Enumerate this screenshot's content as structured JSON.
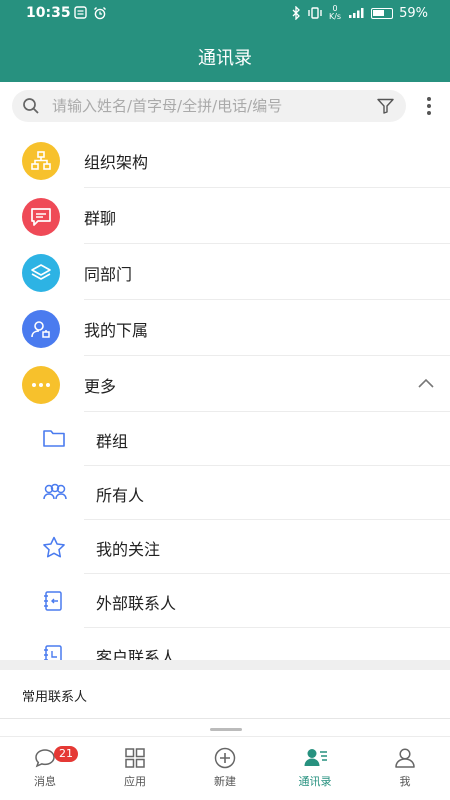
{
  "status_bar": {
    "time": "10:35",
    "battery": "59%",
    "net_speed_value": "0",
    "net_speed_unit": "K/s"
  },
  "header": {
    "title": "通讯录"
  },
  "search": {
    "placeholder": "请输入姓名/首字母/全拼/电话/编号",
    "icon": "search-icon",
    "filter_icon": "filter-icon"
  },
  "menu_items": [
    {
      "label": "组织架构",
      "icon": "org-chart-icon",
      "color": "#f7c12c"
    },
    {
      "label": "群聊",
      "icon": "chat-icon",
      "color": "#ef4a57"
    },
    {
      "label": "同部门",
      "icon": "layers-icon",
      "color": "#2db3e4"
    },
    {
      "label": "我的下属",
      "icon": "subordinate-icon",
      "color": "#4a7bef"
    },
    {
      "label": "更多",
      "icon": "more-icon",
      "color": "#f7c12c",
      "expanded": true
    }
  ],
  "more_items": [
    {
      "label": "群组",
      "icon": "folder-icon"
    },
    {
      "label": "所有人",
      "icon": "people-icon"
    },
    {
      "label": "我的关注",
      "icon": "star-icon"
    },
    {
      "label": "外部联系人",
      "icon": "external-contact-icon"
    },
    {
      "label": "客户联系人",
      "icon": "customer-contact-icon"
    }
  ],
  "frequent_section": {
    "label": "常用联系人"
  },
  "tabs": [
    {
      "label": "消息",
      "icon": "message-icon",
      "badge": "21",
      "active": false
    },
    {
      "label": "应用",
      "icon": "apps-icon",
      "active": false
    },
    {
      "label": "新建",
      "icon": "add-circle-icon",
      "active": false
    },
    {
      "label": "通讯录",
      "icon": "contacts-icon",
      "active": true
    },
    {
      "label": "我",
      "icon": "profile-icon",
      "active": false
    }
  ],
  "colors": {
    "primary": "#27917f",
    "badge": "#e53935",
    "icon_blue": "#4a7bef"
  }
}
